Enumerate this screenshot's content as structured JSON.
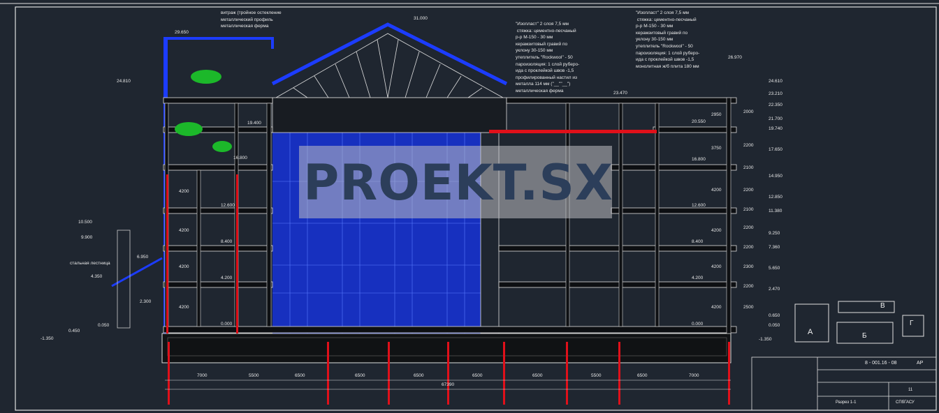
{
  "notes": {
    "top_left": "витраж (тройное остекление\nметаллический профиль\nметаллическая ферма",
    "roof1": "\"Изопласт\" 2 слоя 7,5 мм\n стяжка: цементно-песчаный\nр-р М-150 - 30 мм\nкерамзитовый гравий по\nуклону 30-150 мм\nутеплитель \"Rockwool\" - 50\nпароизоляция: 1 слой руберо-\nида с проклейкой швов -1,5\nпрофилированный настил из\nметалла 114 мм (\"__\"\"__\")\nметаллическая ферма",
    "roof2": "\"Изопласт\" 2 слоя 7,5 мм\n стяжка: цементно-песчаный\nр-р М-150 - 30 мм\nкерамзитовый гравий по\nуклону 30-150 мм\nутеплитель \"Rockwool\" - 50\nпароизоляция: 1 слой руберо-\nида с проклейкой швов -1,5\nмонолитная ж/б плита 180 мм"
  },
  "elevations": {
    "left": [
      "29.650",
      "24.810",
      "19.400",
      "16.800",
      "12.600",
      "8.400",
      "4.200",
      "0.000"
    ],
    "ridge": "31.000",
    "roof_mid": "23.470",
    "right_top": "26.970",
    "right": [
      "20.550",
      "16.800",
      "12.600",
      "8.400",
      "4.200",
      "0.000"
    ],
    "stair_left": [
      "10.500",
      "9.900",
      "6.950",
      "4.350",
      "2.300",
      "0.450",
      "0.050",
      "-1.350"
    ],
    "far_right": [
      "24.610",
      "23.210",
      "22.350",
      "21.700",
      "19.740",
      "17.650",
      "14.950",
      "12.850",
      "11.380",
      "9.250",
      "7.360",
      "5.650",
      "2.470",
      "0.650",
      "0.050",
      "-1.350"
    ]
  },
  "vertical_dims": {
    "left": [
      "4200",
      "4200",
      "4200",
      "4200"
    ],
    "right_a": [
      "2950",
      "3750",
      "4200",
      "4200",
      "4200",
      "4200"
    ],
    "right_b": [
      "2000",
      "2200",
      "2100",
      "2200",
      "2100",
      "2200",
      "2200",
      "2300",
      "2200",
      "2500"
    ]
  },
  "horizontal_dims": {
    "spans": [
      "7000",
      "5500",
      "6500",
      "6500",
      "6500",
      "6500",
      "6500",
      "5500",
      "6500",
      "7000"
    ],
    "total": "67390"
  },
  "watermark": "PROEKT.SX",
  "keyplan": {
    "a": "А",
    "b": "Б",
    "v": "В",
    "g": "Г"
  },
  "title_block": {
    "code": "8 - 001.16 - 08",
    "stage": "АР",
    "sheet": "11",
    "title": "Разрез 1-1",
    "org": "СПбГАСУ"
  },
  "small_labels": {
    "stair_note": "стальная лестница"
  },
  "colors": {
    "background": "#1f2630",
    "blue": "#1c3cff",
    "red": "#e0101a",
    "line": "#e8e8e8"
  }
}
